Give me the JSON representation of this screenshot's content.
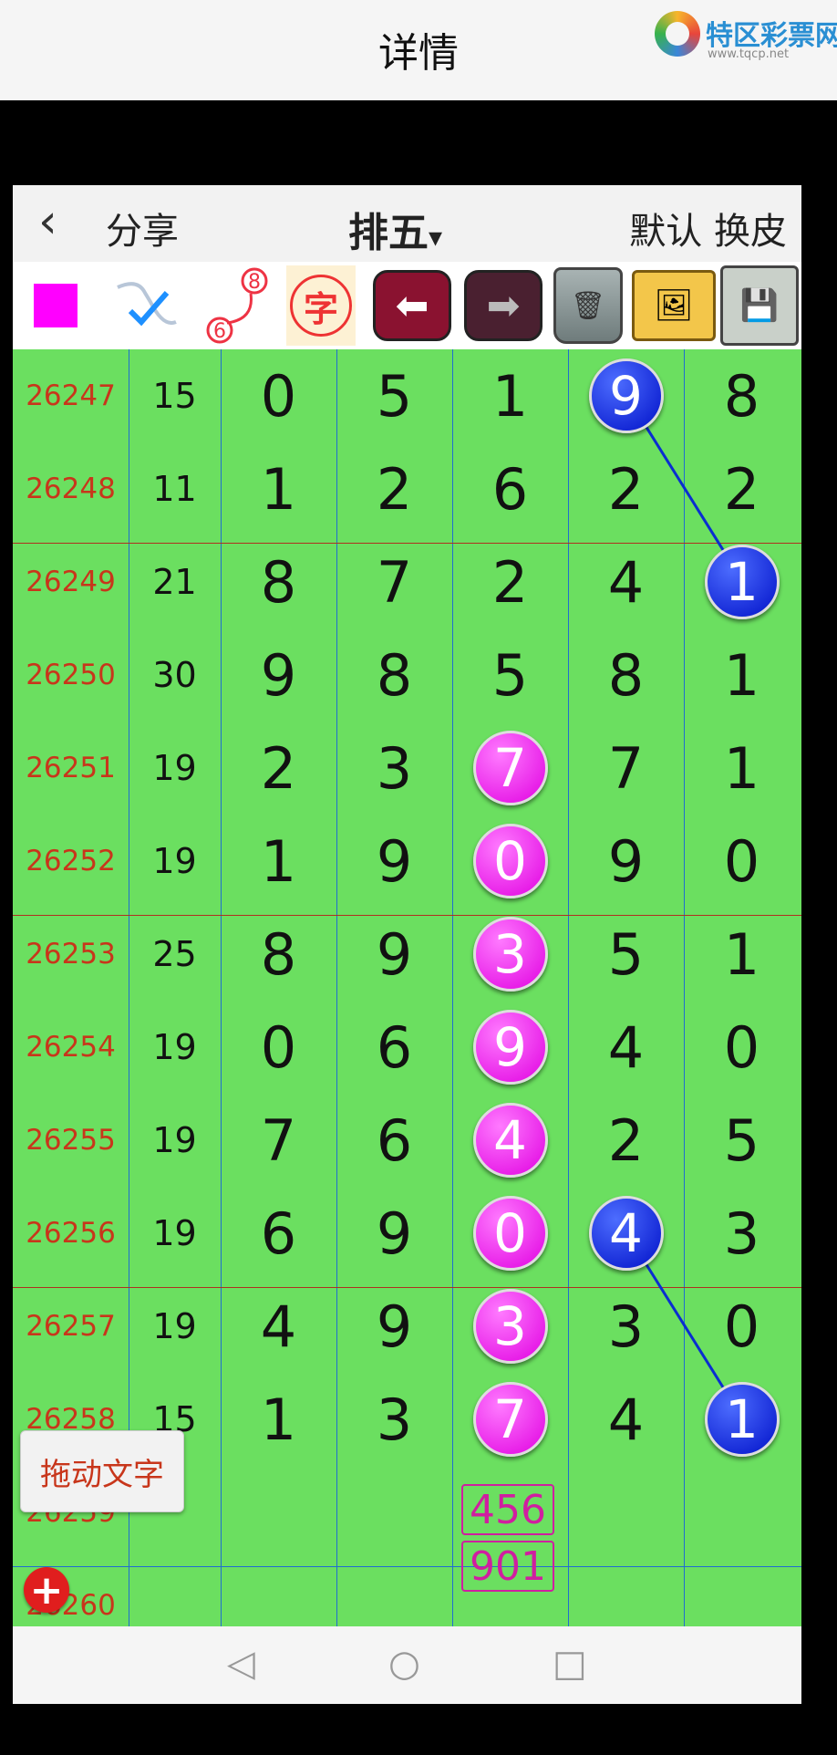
{
  "topbar": {
    "title": "详情",
    "logo_text": "特区彩票网",
    "logo_sub": "www.tqcp.net"
  },
  "app": {
    "back_icon": "‹",
    "share": "分享",
    "game": "排五",
    "dropdown_caret": "▾",
    "default": "默认",
    "skin": "换皮"
  },
  "toolbar": {
    "zi": "字",
    "num_top": "8",
    "num_bottom": "6",
    "arrow_left": "⬅",
    "arrow_right": "➡",
    "icons": [
      "color-square-icon",
      "pen-tool-icon",
      "number-link-icon",
      "text-char-icon",
      "undo-arrow-icon",
      "redo-arrow-icon",
      "trash-icon",
      "photos-icon",
      "floppy-save-icon"
    ]
  },
  "rows": [
    {
      "issue": "26247",
      "sum": "15",
      "d": [
        "0",
        "5",
        "1",
        "9",
        "8"
      ]
    },
    {
      "issue": "26248",
      "sum": "11",
      "d": [
        "1",
        "2",
        "6",
        "2",
        "2"
      ]
    },
    {
      "issue": "26249",
      "sum": "21",
      "d": [
        "8",
        "7",
        "2",
        "4",
        "1"
      ]
    },
    {
      "issue": "26250",
      "sum": "30",
      "d": [
        "9",
        "8",
        "5",
        "8",
        "1"
      ]
    },
    {
      "issue": "26251",
      "sum": "19",
      "d": [
        "2",
        "3",
        "7",
        "7",
        "1"
      ]
    },
    {
      "issue": "26252",
      "sum": "19",
      "d": [
        "1",
        "9",
        "0",
        "9",
        "0"
      ]
    },
    {
      "issue": "26253",
      "sum": "25",
      "d": [
        "8",
        "9",
        "3",
        "5",
        "1"
      ]
    },
    {
      "issue": "26254",
      "sum": "19",
      "d": [
        "0",
        "6",
        "9",
        "4",
        "0"
      ]
    },
    {
      "issue": "26255",
      "sum": "19",
      "d": [
        "7",
        "6",
        "4",
        "2",
        "5"
      ]
    },
    {
      "issue": "26256",
      "sum": "19",
      "d": [
        "6",
        "9",
        "0",
        "4",
        "3"
      ]
    },
    {
      "issue": "26257",
      "sum": "19",
      "d": [
        "4",
        "9",
        "3",
        "3",
        "0"
      ]
    },
    {
      "issue": "26258",
      "sum": "15",
      "d": [
        "1",
        "3",
        "7",
        "4",
        "1"
      ]
    },
    {
      "issue": "26259",
      "sum": "",
      "d": [
        "",
        "",
        "",
        "",
        ""
      ]
    },
    {
      "issue": "26260",
      "sum": "",
      "d": [
        "",
        "",
        "",
        "",
        ""
      ]
    }
  ],
  "prediction": {
    "line1": "456",
    "line2": "901"
  },
  "drag_text_button": "拖动文字",
  "plus_icon": "+",
  "updown_icon": "⇕",
  "nav": {
    "back": "◁",
    "home": "○",
    "recent": "□"
  },
  "colors": {
    "grid_bg": "#6bdf60",
    "pink_ball": "#e000e0",
    "blue_ball": "#0010c8",
    "issue_text": "#c8361b"
  }
}
